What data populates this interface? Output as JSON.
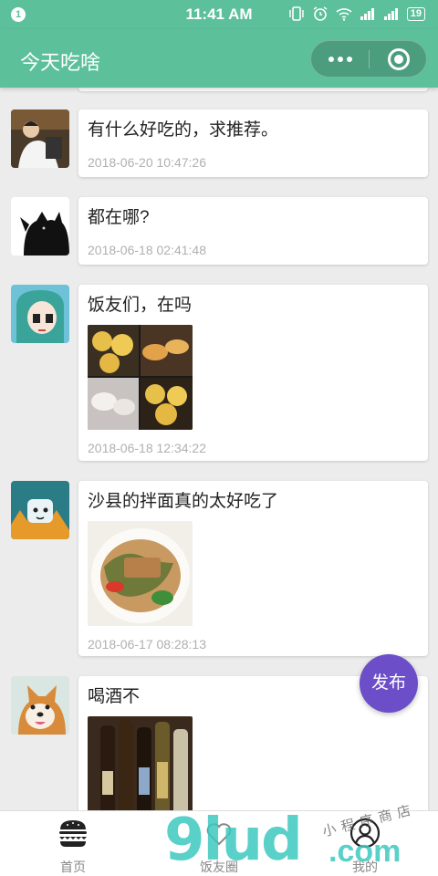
{
  "status_bar": {
    "notification_count": "1",
    "time": "11:41 AM",
    "battery": "19"
  },
  "nav": {
    "title": "今天吃啥"
  },
  "posts": [
    {
      "text": "有什么好吃的，求推荐。",
      "time": "2018-06-20 10:47:26"
    },
    {
      "text": "都在哪?",
      "time": "2018-06-18 02:41:48"
    },
    {
      "text": "饭友们，在吗",
      "time": "2018-06-18 12:34:22"
    },
    {
      "text": "沙县的拌面真的太好吃了",
      "time": "2018-06-17 08:28:13"
    },
    {
      "text": "喝酒不",
      "time": ""
    }
  ],
  "fab": {
    "label": "发布"
  },
  "tabs": [
    {
      "label": "首页",
      "icon": "burger-icon"
    },
    {
      "label": "饭友圈",
      "icon": "heart-icon"
    },
    {
      "label": "我的",
      "icon": "user-icon"
    }
  ],
  "watermark": {
    "big": "9lud",
    "small": "小程序商店",
    "com": ".com"
  }
}
